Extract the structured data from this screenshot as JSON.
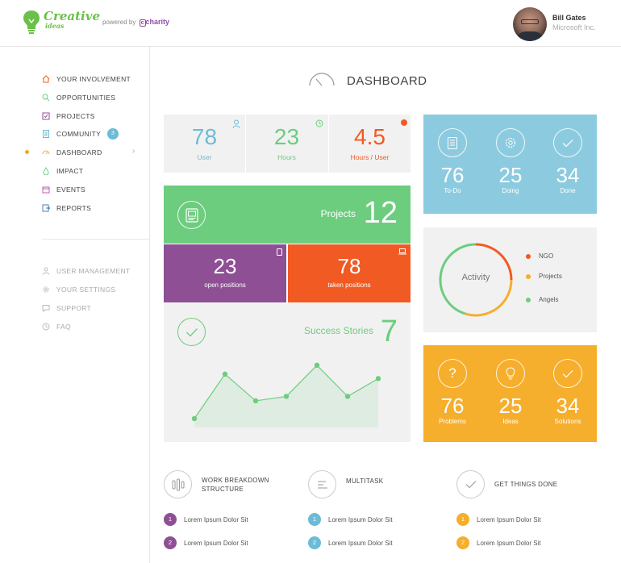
{
  "brand": {
    "name_line1": "Creative",
    "name_line2": "ideas",
    "powered_by": "powered by",
    "partner": "charity"
  },
  "user": {
    "name": "Bill Gates",
    "company": "Microsoft Inc."
  },
  "sidebar": {
    "items": [
      {
        "label": "YOUR INVOLVEMENT",
        "icon": "home-icon"
      },
      {
        "label": "OPPORTUNITIES",
        "icon": "search-icon"
      },
      {
        "label": "PROJECTS",
        "icon": "checkbox-icon"
      },
      {
        "label": "COMMUNITY",
        "icon": "document-icon",
        "badge": "3"
      },
      {
        "label": "DASHBOARD",
        "icon": "gauge-icon",
        "active": true
      },
      {
        "label": "IMPACT",
        "icon": "drop-icon"
      },
      {
        "label": "EVENTS",
        "icon": "calendar-icon"
      },
      {
        "label": "REPORTS",
        "icon": "export-icon"
      }
    ],
    "secondary": [
      {
        "label": "USER MANAGEMENT",
        "icon": "user-icon"
      },
      {
        "label": "YOUR SETTINGS",
        "icon": "gear-icon"
      },
      {
        "label": "SUPPORT",
        "icon": "chat-icon"
      },
      {
        "label": "FAQ",
        "icon": "clock-icon"
      }
    ]
  },
  "dashboard": {
    "title": "DASHBOARD"
  },
  "stats": [
    {
      "value": "78",
      "label": "User",
      "color": "#6bbcd6"
    },
    {
      "value": "23",
      "label": "Hours",
      "color": "#6ccd7e"
    },
    {
      "value": "4.5",
      "label": "Hours / User",
      "color": "#f15a22"
    }
  ],
  "projects": {
    "label": "Projects",
    "value": "12"
  },
  "positions": [
    {
      "value": "23",
      "label": "open positions",
      "color": "#8e4f94"
    },
    {
      "value": "78",
      "label": "taken positions",
      "color": "#f15a22"
    }
  ],
  "success": {
    "label": "Success Stories",
    "value": "7"
  },
  "chart_data": {
    "type": "area",
    "x": [
      1,
      2,
      3,
      4,
      5,
      6,
      7
    ],
    "values": [
      1,
      6,
      3,
      3.5,
      7,
      3.5,
      5.5
    ],
    "ylim": [
      0,
      8
    ],
    "grid": false,
    "color": "#6ccd7e"
  },
  "tasks": [
    {
      "value": "76",
      "label": "To-Do",
      "icon": "list-icon"
    },
    {
      "value": "25",
      "label": "Doing",
      "icon": "gear-icon"
    },
    {
      "value": "34",
      "label": "Done",
      "icon": "check-icon"
    }
  ],
  "activity": {
    "label": "Activity",
    "legend": [
      {
        "label": "NGO",
        "color": "#f15a22"
      },
      {
        "label": "Projects",
        "color": "#f6ae2d"
      },
      {
        "label": "Angels",
        "color": "#6ccd7e"
      }
    ],
    "shares": [
      0.25,
      0.3,
      0.45
    ]
  },
  "ideas": [
    {
      "value": "76",
      "label": "Problems",
      "icon": "question-icon"
    },
    {
      "value": "25",
      "label": "Ideas",
      "icon": "lightbulb-icon"
    },
    {
      "value": "34",
      "label": "Solutions",
      "icon": "check-icon"
    }
  ],
  "features": [
    {
      "title": "WORK BREAKDOWN STRUCTURE",
      "icon": "tree-icon",
      "color": "#8e4f94",
      "items": [
        "Lorem Ipsum Dolor Sit",
        "Lorem Ipsum Dolor Sit"
      ]
    },
    {
      "title": "MULTITASK",
      "icon": "lines-icon",
      "color": "#6bbcd6",
      "items": [
        "Lorem Ipsum Dolor Sit",
        "Lorem Ipsum Dolor Sit"
      ]
    },
    {
      "title": "GET THINGS DONE",
      "icon": "check-icon",
      "color": "#f6ae2d",
      "items": [
        "Lorem Ipsum Dolor Sit",
        "Lorem Ipsum Dolor Sit"
      ]
    }
  ]
}
